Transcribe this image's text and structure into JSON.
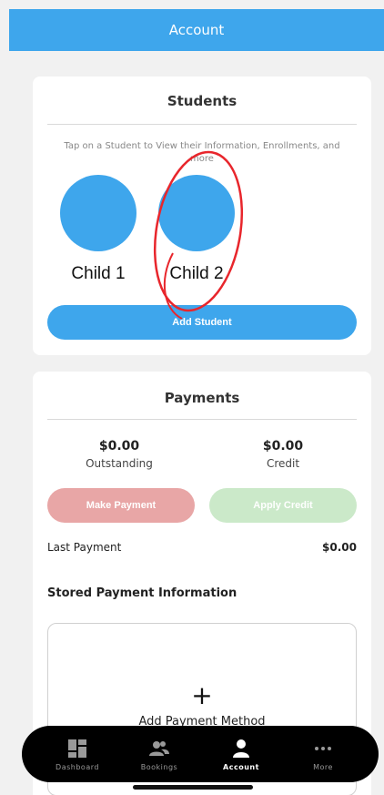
{
  "header": {
    "title": "Account"
  },
  "students": {
    "title": "Students",
    "hint": "Tap on a Student to View their Information, Enrollments, and more",
    "items": [
      {
        "name": "Child 1"
      },
      {
        "name": "Child 2"
      }
    ],
    "add_label": "Add Student"
  },
  "payments": {
    "title": "Payments",
    "outstanding": {
      "value": "$0.00",
      "label": "Outstanding"
    },
    "credit": {
      "value": "$0.00",
      "label": "Credit"
    },
    "make_payment_label": "Make Payment",
    "apply_credit_label": "Apply Credit",
    "last_payment": {
      "label": "Last Payment",
      "value": "$0.00"
    },
    "stored_title": "Stored Payment Information",
    "add_method": {
      "icon": "plus-icon",
      "label": "Add Payment Method"
    }
  },
  "tabbar": {
    "tabs": [
      {
        "label": "Dashboard",
        "icon": "dashboard-icon"
      },
      {
        "label": "Bookings",
        "icon": "people-icon"
      },
      {
        "label": "Account",
        "icon": "person-icon",
        "active": true
      },
      {
        "label": "More",
        "icon": "more-icon"
      }
    ]
  },
  "colors": {
    "primary": "#3ea6ec",
    "make_payment": "#e8a6a6",
    "apply_credit": "#cbe9c9",
    "annotation": "#e8262c"
  }
}
